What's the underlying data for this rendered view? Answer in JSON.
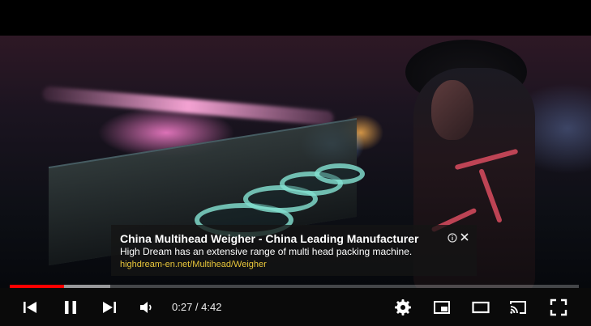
{
  "ad": {
    "title": "China Multihead Weigher - China Leading Manufacturer",
    "description": "High Dream has an extensive range of multi head packing machine.",
    "url": "highdream-en.net/Multihead/Weigher"
  },
  "player": {
    "current_time": "0:27",
    "separator": "/",
    "duration": "4:42",
    "time_display": "0:27 / 4:42",
    "progress_played_fraction": 0.095,
    "progress_loaded_fraction": 0.177
  },
  "icons": {
    "previous": "skip-previous-icon",
    "pause": "pause-icon",
    "next": "skip-next-icon",
    "volume": "volume-icon",
    "settings": "gear-icon",
    "miniplayer": "miniplayer-icon",
    "theater": "theater-mode-icon",
    "cast": "cast-icon",
    "fullscreen": "fullscreen-icon",
    "ad_info": "info-icon",
    "ad_close": "close-icon"
  },
  "colors": {
    "progress_played": "#ff0000",
    "ad_url": "#e8c63a",
    "control_bar": "#0a0a0a"
  }
}
